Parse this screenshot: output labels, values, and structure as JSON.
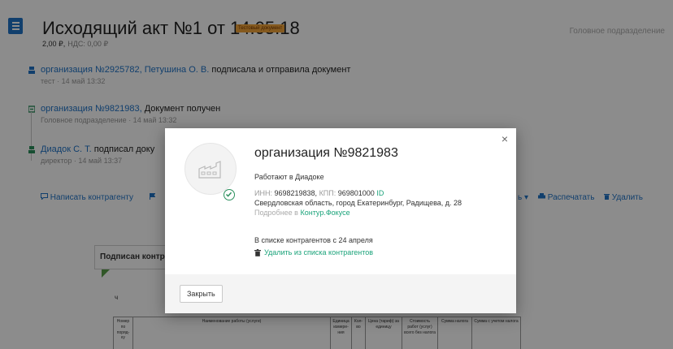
{
  "document": {
    "title": "Исходящий акт №1 от 14.05.18",
    "badge": "Тестовый документ",
    "amount": "2,00 ₽,",
    "vat": "НДС: 0,00 ₽",
    "department": "Головное подразделение"
  },
  "events": [
    {
      "org": "организация №2925782, Петушина О. В.",
      "text": " подписала и отправила документ",
      "meta": "тест · 14 май 13:32"
    },
    {
      "org": "организация №9821983,",
      "text": " Документ получен",
      "meta": "Головное подразделение · 14 май 13:32"
    },
    {
      "org": "Диадок С. Т.",
      "text": " подписал доку",
      "meta": "директор · 14 май 13:37"
    }
  ],
  "actions": {
    "write": "Написать контрагенту",
    "more_suffix": "ь ▾",
    "print": "Распечатать",
    "delete": "Удалить"
  },
  "sheet": {
    "signed_tab": "Подписан контр",
    "ch": "ч",
    "table_headers": [
      "Номер по поряд- ку",
      "Наименование работы (услуги)",
      "Единица измере- ния",
      "Кол-во",
      "Цена (тариф) за единицу",
      "Стоимость работ (услуг) всего без налога",
      "Сумма налога",
      "Сумма с учетом налога"
    ]
  },
  "modal": {
    "org_name": "организация №9821983",
    "works": "Работают в Диадоке",
    "inn_label": "ИНН:",
    "inn": "9698219838,",
    "kpp_label": "КПП:",
    "kpp": "969801000",
    "id_link": "ID",
    "address": "Свердловская область, город Екатеринбург, Радищева, д. 28",
    "more_prefix": "Подробнее в",
    "more_link": "Контур.Фокусе",
    "since": "В списке контрагентов с 24 апреля",
    "remove": "Удалить из списка контрагентов",
    "close_x": "×",
    "close_button": "Закрыть"
  },
  "colors": {
    "accent_blue": "#1f73c7",
    "accent_green": "#1aa37a",
    "badge_orange": "#f2a43a",
    "overlay": "rgba(0,0,0,0.45)"
  },
  "icons": [
    "menu-icon",
    "person-icon",
    "document-received-icon",
    "chat-icon",
    "printer-icon",
    "trash-icon",
    "factory-icon",
    "check-circle-icon",
    "close-icon"
  ]
}
